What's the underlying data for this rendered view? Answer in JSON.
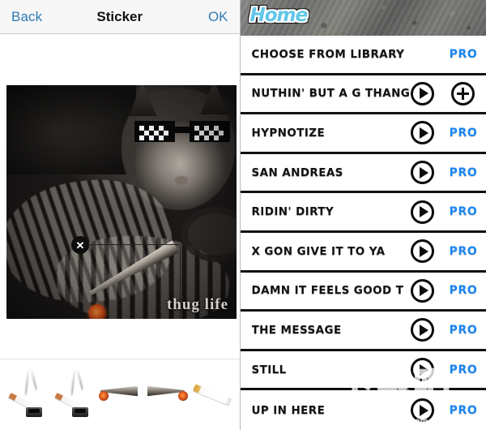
{
  "editor": {
    "nav": {
      "back_label": "Back",
      "title": "Sticker",
      "ok_label": "OK"
    },
    "canvas": {
      "photo_caption": "thug life",
      "delete_handle_glyph": "✕",
      "sticker_name": "joint-sticker"
    },
    "tray": {
      "items": [
        {
          "name": "cigarette-ashtray-smoke-1"
        },
        {
          "name": "cigarette-ashtray-smoke-2"
        },
        {
          "name": "joint-lit-left"
        },
        {
          "name": "joint-lit-right"
        },
        {
          "name": "cigarette-plain"
        }
      ]
    }
  },
  "home": {
    "header": {
      "logo_text": "Home",
      "logo_color": "#62c6e8"
    },
    "pro_label": "PRO",
    "accent_color": "#1a86f0",
    "rows": [
      {
        "title": "CHOOSE FROM LIBRARY",
        "has_play": false,
        "badge": "pro"
      },
      {
        "title": "NUTHIN' BUT A G THANG",
        "has_play": true,
        "badge": "add"
      },
      {
        "title": "HYPNOTIZE",
        "has_play": true,
        "badge": "pro"
      },
      {
        "title": "SAN ANDREAS",
        "has_play": true,
        "badge": "pro"
      },
      {
        "title": "RIDIN' DIRTY",
        "has_play": true,
        "badge": "pro"
      },
      {
        "title": "X GON GIVE IT TO YA",
        "has_play": true,
        "badge": "pro"
      },
      {
        "title": "DAMN IT FEELS GOOD T",
        "has_play": true,
        "badge": "pro"
      },
      {
        "title": "THE MESSAGE",
        "has_play": true,
        "badge": "pro"
      },
      {
        "title": "STILL",
        "has_play": true,
        "badge": "pro"
      },
      {
        "title": "UP IN HERE",
        "has_play": true,
        "badge": "pro"
      }
    ]
  },
  "watermark": {
    "big_text": "下载吧",
    "small_text": "www.xiazaiba.com"
  }
}
